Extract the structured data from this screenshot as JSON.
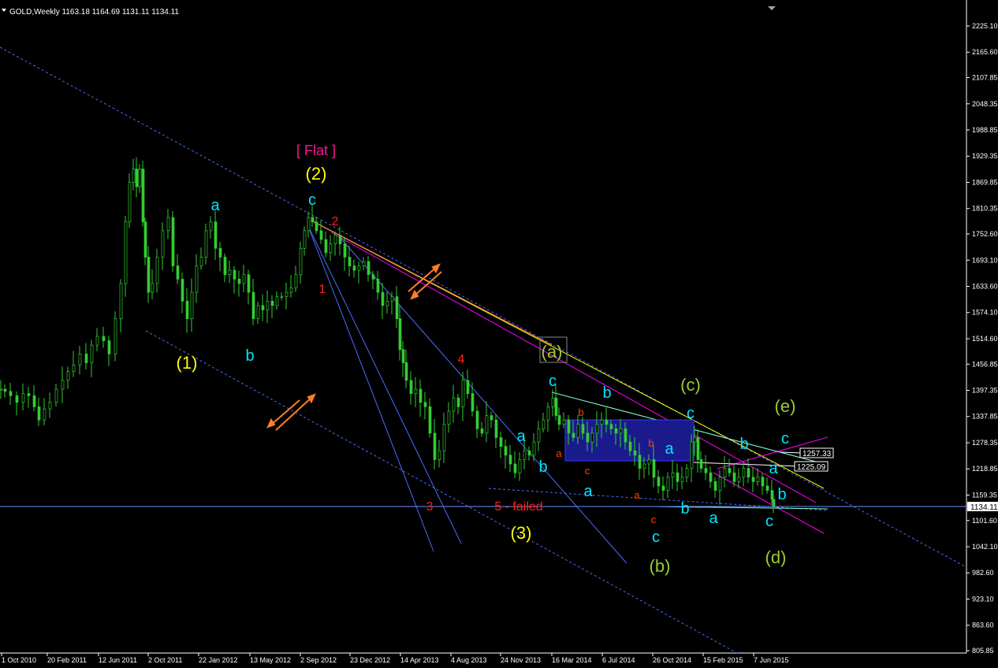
{
  "window": {
    "symbol_info": "GOLD,Weekly  1163.18 1164.69 1131.11 1134.11"
  },
  "chart_data": {
    "type": "candlestick",
    "symbol": "GOLD",
    "timeframe": "Weekly",
    "ohlc_readout": {
      "open": 1163.18,
      "high": 1164.69,
      "low": 1131.11,
      "close": 1134.11
    },
    "ylim": [
      805.85,
      2250
    ],
    "y_ticks": [
      2225.1,
      2165.6,
      2107.85,
      2048.35,
      1988.85,
      1929.35,
      1869.85,
      1810.35,
      1752.6,
      1693.1,
      1633.6,
      1574.1,
      1514.6,
      1456.85,
      1397.35,
      1337.85,
      1278.35,
      1218.85,
      1159.35,
      1101.6,
      1042.1,
      982.6,
      923.1,
      863.6,
      805.85
    ],
    "y_tick_labels": [
      "2225.10",
      "2165.60",
      "2107.85",
      "2048.35",
      "1988.85",
      "1929.35",
      "1869.85",
      "1810.35",
      "1752.60",
      "1693.10",
      "1633.60",
      "1574.10",
      "1514.60",
      "1456.85",
      "1397.35",
      "1337.85",
      "1278.35",
      "1218.85",
      "1159.35",
      "1101.60",
      "1042.10",
      "982.60",
      "923.10",
      "863.60",
      "805.85"
    ],
    "x_tick_labels": [
      "1 Oct 2010",
      "20 Feb 2011",
      "12 Jun 2011",
      "2 Oct 2011",
      "22 Jan 2012",
      "13 May 2012",
      "2 Sep 2012",
      "23 Dec 2012",
      "14 Apr 2013",
      "4 Aug 2013",
      "24 Nov 2013",
      "16 Mar 2014",
      "6 Jul 2014",
      "26 Oct 2014",
      "15 Feb 2015",
      "7 Jun 2015"
    ],
    "current_price": "1134.11",
    "price_markers": [
      "1257.33",
      "1225.09"
    ],
    "price_path": [
      [
        0,
        1400
      ],
      [
        5,
        1395
      ],
      [
        12,
        1385
      ],
      [
        20,
        1370
      ],
      [
        28,
        1390
      ],
      [
        35,
        1385
      ],
      [
        42,
        1360
      ],
      [
        48,
        1330
      ],
      [
        55,
        1355
      ],
      [
        62,
        1370
      ],
      [
        70,
        1400
      ],
      [
        78,
        1420
      ],
      [
        85,
        1440
      ],
      [
        92,
        1455
      ],
      [
        100,
        1480
      ],
      [
        108,
        1460
      ],
      [
        115,
        1500
      ],
      [
        122,
        1520
      ],
      [
        130,
        1510
      ],
      [
        137,
        1480
      ],
      [
        145,
        1560
      ],
      [
        152,
        1640
      ],
      [
        158,
        1780
      ],
      [
        163,
        1870
      ],
      [
        168,
        1900
      ],
      [
        172,
        1860
      ],
      [
        176,
        1900
      ],
      [
        180,
        1780
      ],
      [
        183,
        1700
      ],
      [
        187,
        1620
      ],
      [
        192,
        1640
      ],
      [
        198,
        1700
      ],
      [
        205,
        1760
      ],
      [
        212,
        1790
      ],
      [
        218,
        1680
      ],
      [
        224,
        1650
      ],
      [
        230,
        1600
      ],
      [
        236,
        1560
      ],
      [
        242,
        1620
      ],
      [
        248,
        1680
      ],
      [
        254,
        1700
      ],
      [
        260,
        1760
      ],
      [
        266,
        1780
      ],
      [
        272,
        1720
      ],
      [
        278,
        1700
      ],
      [
        284,
        1660
      ],
      [
        290,
        1670
      ],
      [
        296,
        1650
      ],
      [
        302,
        1640
      ],
      [
        308,
        1660
      ],
      [
        314,
        1620
      ],
      [
        320,
        1560
      ],
      [
        326,
        1590
      ],
      [
        332,
        1580
      ],
      [
        338,
        1600
      ],
      [
        344,
        1590
      ],
      [
        350,
        1610
      ],
      [
        356,
        1610
      ],
      [
        362,
        1620
      ],
      [
        368,
        1630
      ],
      [
        374,
        1660
      ],
      [
        380,
        1720
      ],
      [
        385,
        1760
      ],
      [
        390,
        1790
      ],
      [
        395,
        1780
      ],
      [
        400,
        1760
      ],
      [
        406,
        1740
      ],
      [
        412,
        1710
      ],
      [
        418,
        1730
      ],
      [
        424,
        1750
      ],
      [
        430,
        1730
      ],
      [
        436,
        1700
      ],
      [
        442,
        1680
      ],
      [
        448,
        1670
      ],
      [
        454,
        1680
      ],
      [
        460,
        1690
      ],
      [
        466,
        1660
      ],
      [
        472,
        1650
      ],
      [
        478,
        1620
      ],
      [
        484,
        1590
      ],
      [
        490,
        1600
      ],
      [
        496,
        1610
      ],
      [
        502,
        1560
      ],
      [
        506,
        1490
      ],
      [
        510,
        1460
      ],
      [
        514,
        1420
      ],
      [
        520,
        1390
      ],
      [
        526,
        1400
      ],
      [
        532,
        1370
      ],
      [
        538,
        1360
      ],
      [
        544,
        1300
      ],
      [
        550,
        1240
      ],
      [
        556,
        1260
      ],
      [
        562,
        1320
      ],
      [
        568,
        1350
      ],
      [
        574,
        1380
      ],
      [
        580,
        1360
      ],
      [
        586,
        1420
      ],
      [
        592,
        1390
      ],
      [
        598,
        1350
      ],
      [
        604,
        1310
      ],
      [
        610,
        1300
      ],
      [
        616,
        1340
      ],
      [
        622,
        1330
      ],
      [
        628,
        1290
      ],
      [
        634,
        1270
      ],
      [
        640,
        1250
      ],
      [
        646,
        1230
      ],
      [
        652,
        1210
      ],
      [
        658,
        1240
      ],
      [
        664,
        1260
      ],
      [
        670,
        1250
      ],
      [
        676,
        1280
      ],
      [
        682,
        1310
      ],
      [
        688,
        1330
      ],
      [
        694,
        1360
      ],
      [
        700,
        1380
      ],
      [
        704,
        1340
      ],
      [
        708,
        1320
      ],
      [
        714,
        1330
      ],
      [
        720,
        1300
      ],
      [
        726,
        1290
      ],
      [
        732,
        1320
      ],
      [
        738,
        1300
      ],
      [
        744,
        1280
      ],
      [
        750,
        1300
      ],
      [
        756,
        1320
      ],
      [
        762,
        1330
      ],
      [
        768,
        1320
      ],
      [
        774,
        1310
      ],
      [
        780,
        1300
      ],
      [
        786,
        1310
      ],
      [
        792,
        1280
      ],
      [
        798,
        1260
      ],
      [
        804,
        1250
      ],
      [
        810,
        1220
      ],
      [
        816,
        1230
      ],
      [
        822,
        1240
      ],
      [
        828,
        1200
      ],
      [
        834,
        1180
      ],
      [
        840,
        1170
      ],
      [
        846,
        1200
      ],
      [
        852,
        1210
      ],
      [
        858,
        1190
      ],
      [
        864,
        1200
      ],
      [
        870,
        1220
      ],
      [
        876,
        1280
      ],
      [
        880,
        1290
      ],
      [
        884,
        1240
      ],
      [
        888,
        1220
      ],
      [
        894,
        1210
      ],
      [
        900,
        1190
      ],
      [
        906,
        1170
      ],
      [
        912,
        1200
      ],
      [
        918,
        1220
      ],
      [
        924,
        1210
      ],
      [
        930,
        1190
      ],
      [
        936,
        1200
      ],
      [
        942,
        1220
      ],
      [
        948,
        1200
      ],
      [
        954,
        1190
      ],
      [
        960,
        1200
      ],
      [
        966,
        1180
      ],
      [
        972,
        1170
      ],
      [
        978,
        1150
      ],
      [
        980,
        1134
      ]
    ],
    "annotations": [
      {
        "text": "[ Flat ]",
        "color": "#ff1493"
      },
      {
        "text": "(2)",
        "color": "#ffff00"
      },
      {
        "text": "c",
        "color": "#00e5ff"
      },
      {
        "text": "2",
        "color": "#ff2020"
      },
      {
        "text": "a",
        "color": "#00e5ff"
      },
      {
        "text": "b",
        "color": "#00e5ff"
      },
      {
        "text": "(1)",
        "color": "#ffff00"
      },
      {
        "text": "1",
        "color": "#ff2020"
      },
      {
        "text": "4",
        "color": "#ff2020"
      },
      {
        "text": "3",
        "color": "#ff2020"
      },
      {
        "text": "5 - failed",
        "color": "#ff2020"
      },
      {
        "text": "(3)",
        "color": "#ffff00"
      },
      {
        "text": "(a)",
        "color": "#9acd32"
      },
      {
        "text": "c",
        "color": "#00e5ff"
      },
      {
        "text": "b",
        "color": "#00e5ff"
      },
      {
        "text": "a",
        "color": "#00e5ff"
      },
      {
        "text": "b",
        "color": "#00e5ff"
      },
      {
        "text": "a",
        "color": "#00e5ff"
      },
      {
        "text": "b",
        "color": "#ff4500"
      },
      {
        "text": "a",
        "color": "#ff4500"
      },
      {
        "text": "c",
        "color": "#ff4500"
      },
      {
        "text": "b",
        "color": "#ff4500"
      },
      {
        "text": "a",
        "color": "#ff4500"
      },
      {
        "text": "c",
        "color": "#ff4500"
      },
      {
        "text": "c",
        "color": "#00e5ff"
      },
      {
        "text": "(b)",
        "color": "#9acd32"
      },
      {
        "text": "(c)",
        "color": "#9acd32"
      },
      {
        "text": "c",
        "color": "#00e5ff"
      },
      {
        "text": "a",
        "color": "#00e5ff"
      },
      {
        "text": "b",
        "color": "#00e5ff"
      },
      {
        "text": "a",
        "color": "#00e5ff"
      },
      {
        "text": "(e)",
        "color": "#9acd32"
      },
      {
        "text": "c",
        "color": "#00e5ff"
      },
      {
        "text": "b",
        "color": "#00e5ff"
      },
      {
        "text": "a",
        "color": "#00e5ff"
      },
      {
        "text": "b",
        "color": "#00e5ff"
      },
      {
        "text": "c",
        "color": "#00e5ff"
      },
      {
        "text": "(d)",
        "color": "#9acd32"
      }
    ],
    "grid": false,
    "colors": {
      "background": "#000000",
      "candles": "#32cd32",
      "axis": "#ffffff"
    }
  }
}
